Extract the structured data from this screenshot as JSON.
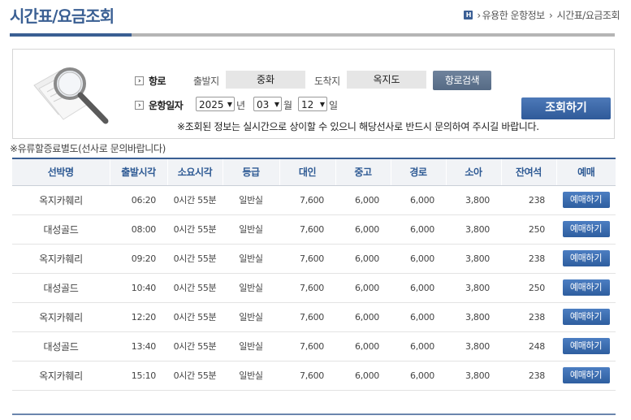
{
  "header": {
    "title": "시간표/요금조회",
    "breadcrumb": [
      "유용한 운항정보",
      "시간표/요금조회"
    ],
    "home_icon_label": "H"
  },
  "search": {
    "route_label": "항로",
    "departure_label": "출발지",
    "departure_value": "중화",
    "arrival_label": "도착지",
    "arrival_value": "옥지도",
    "route_search_label": "항로검색",
    "date_label": "운항일자",
    "year": "2025",
    "year_unit": "년",
    "month": "03",
    "month_unit": "월",
    "day": "12",
    "day_unit": "일",
    "query_button": "조회하기",
    "notice": "※조회된 정보는 실시간으로 상이할 수 있으니 해당선사로 반드시 문의하여 주시길 바랍니다."
  },
  "sub_note": "※유류할증료별도(선사로 문의바랍니다)",
  "table": {
    "headers": [
      "선박명",
      "출발시각",
      "소요시각",
      "등급",
      "대인",
      "중고",
      "경로",
      "소아",
      "잔여석",
      "예매"
    ],
    "buy_label": "예매하기",
    "rows": [
      {
        "ship": "옥지카훼리",
        "time": "06:20",
        "duration": "0시간 55분",
        "grade": "일반실",
        "adult": "7,600",
        "teen": "6,000",
        "senior": "6,000",
        "child": "3,800",
        "seats": "238"
      },
      {
        "ship": "대성골드",
        "time": "08:00",
        "duration": "0시간 55분",
        "grade": "일반실",
        "adult": "7,600",
        "teen": "6,000",
        "senior": "6,000",
        "child": "3,800",
        "seats": "250"
      },
      {
        "ship": "옥지카훼리",
        "time": "09:20",
        "duration": "0시간 55분",
        "grade": "일반실",
        "adult": "7,600",
        "teen": "6,000",
        "senior": "6,000",
        "child": "3,800",
        "seats": "238"
      },
      {
        "ship": "대성골드",
        "time": "10:40",
        "duration": "0시간 55분",
        "grade": "일반실",
        "adult": "7,600",
        "teen": "6,000",
        "senior": "6,000",
        "child": "3,800",
        "seats": "250"
      },
      {
        "ship": "옥지카훼리",
        "time": "12:20",
        "duration": "0시간 55분",
        "grade": "일반실",
        "adult": "7,600",
        "teen": "6,000",
        "senior": "6,000",
        "child": "3,800",
        "seats": "238"
      },
      {
        "ship": "대성골드",
        "time": "13:40",
        "duration": "0시간 55분",
        "grade": "일반실",
        "adult": "7,600",
        "teen": "6,000",
        "senior": "6,000",
        "child": "3,800",
        "seats": "248"
      },
      {
        "ship": "옥지카훼리",
        "time": "15:10",
        "duration": "0시간 55분",
        "grade": "일반실",
        "adult": "7,600",
        "teen": "6,000",
        "senior": "6,000",
        "child": "3,800",
        "seats": "238"
      }
    ]
  },
  "colors": {
    "brand": "#3a5f93",
    "button": "#2e5e9f",
    "header_bg": "#f1f3f6"
  }
}
